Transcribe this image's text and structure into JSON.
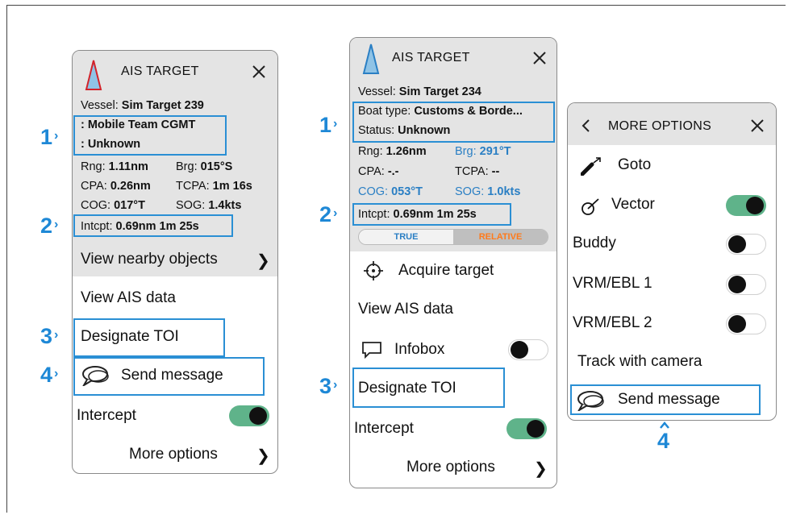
{
  "panel1": {
    "title": "AIS TARGET",
    "vessel_label": "Vessel:",
    "vessel_value": "Sim Target 239",
    "row_team": ": Mobile Team CGMT",
    "row_status": ": Unknown",
    "rng_label": "Rng:",
    "rng_value": "1.11nm",
    "brg_label": "Brg:",
    "brg_value": "015°S",
    "cpa_label": "CPA:",
    "cpa_value": "0.26nm",
    "tcpa_label": "TCPA:",
    "tcpa_value": "1m 16s",
    "cog_label": "COG:",
    "cog_value": "017°T",
    "sog_label": "SOG:",
    "sog_value": "1.4kts",
    "intcpt_label": "Intcpt:",
    "intcpt_value": "0.69nm 1m 25s",
    "nearby": "View nearby objects",
    "view_ais": "View AIS data",
    "designate": "Designate TOI",
    "send": "Send message",
    "intercept": "Intercept",
    "more": "More options"
  },
  "panel2": {
    "title": "AIS TARGET",
    "vessel_label": "Vessel:",
    "vessel_value": "Sim Target 234",
    "boat_label": "Boat type:",
    "boat_value": "Customs & Borde...",
    "status_label": "Status:",
    "status_value": "Unknown",
    "rng_label": "Rng:",
    "rng_value": "1.26nm",
    "brg_label": "Brg:",
    "brg_value": "291°T",
    "cpa_label": "CPA:",
    "cpa_value": "-.-",
    "tcpa_label": "TCPA:",
    "tcpa_value": "--",
    "cog_label": "COG:",
    "cog_value": "053°T",
    "sog_label": "SOG:",
    "sog_value": "1.0kts",
    "intcpt_label": "Intcpt:",
    "intcpt_value": "0.69nm 1m 25s",
    "seg_true": "TRUE",
    "seg_relative": "RELATIVE",
    "acquire": "Acquire target",
    "view_ais": "View AIS data",
    "infobox": "Infobox",
    "designate": "Designate TOI",
    "intercept": "Intercept",
    "more": "More options"
  },
  "panel3": {
    "title": "MORE OPTIONS",
    "goto": "Goto",
    "vector": "Vector",
    "buddy": "Buddy",
    "vrm1": "VRM/EBL 1",
    "vrm2": "VRM/EBL 2",
    "track": "Track with camera",
    "send": "Send message"
  },
  "callouts": {
    "p1_n1": "1",
    "p1_n2": "2",
    "p1_n3": "3",
    "p1_n4": "4",
    "p2_n1": "1",
    "p2_n2": "2",
    "p2_n3": "3",
    "p3_n4": "4"
  },
  "toggles": {
    "p1_intercept": true,
    "p2_infobox": false,
    "p2_intercept": true,
    "p3_vector": true,
    "p3_buddy": false,
    "p3_vrm1": false,
    "p3_vrm2": false
  },
  "colors": {
    "callout": "#2a8fd4",
    "toggle_on": "#5fb38a",
    "accent_blue": "#2a7fc4",
    "relative_orange": "#ff7a1a"
  }
}
